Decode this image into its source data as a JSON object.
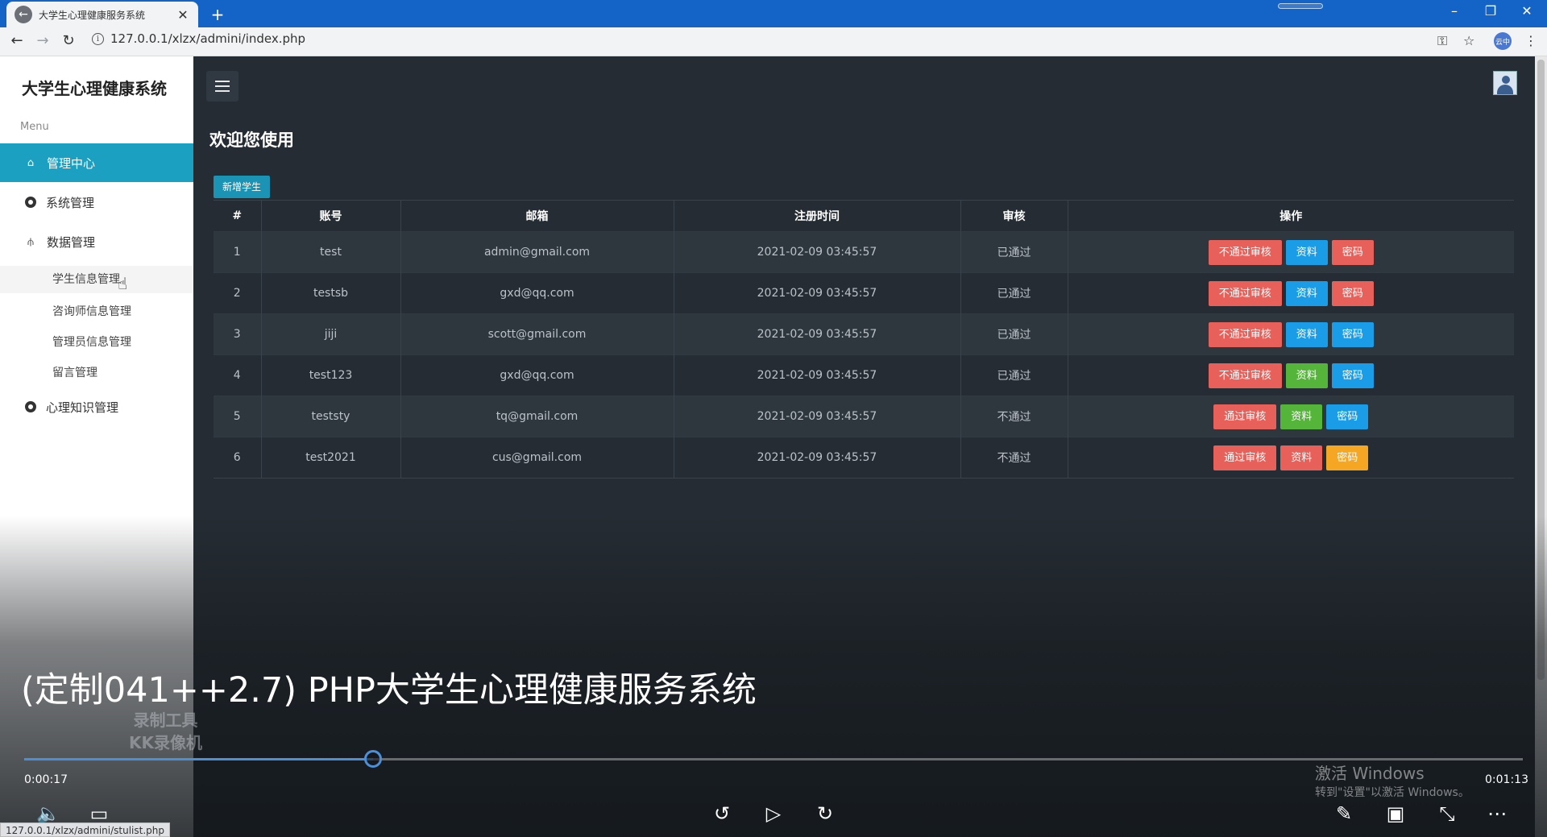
{
  "browser": {
    "tab_title": "大学生心理健康服务系统",
    "url": "127.0.0.1/xlzx/admini/index.php",
    "profile_label": "云中",
    "status_url": "127.0.0.1/xlzx/admini/stulist.php"
  },
  "sidebar": {
    "brand": "大学生心理健康系统",
    "menu_label": "Menu",
    "items": [
      {
        "label": "管理中心",
        "icon": "home-icon",
        "active": true
      },
      {
        "label": "系统管理",
        "icon": "circle-icon"
      },
      {
        "label": "数据管理",
        "icon": "usb-icon"
      },
      {
        "label": "心理知识管理",
        "icon": "circle-icon"
      }
    ],
    "sub_items": [
      {
        "label": "学生信息管理"
      },
      {
        "label": "咨询师信息管理"
      },
      {
        "label": "管理员信息管理"
      },
      {
        "label": "留言管理"
      }
    ]
  },
  "main": {
    "welcome": "欢迎您使用",
    "add_button": "新增学生",
    "table": {
      "headers": [
        "#",
        "账号",
        "邮箱",
        "注册时间",
        "审核",
        "操作"
      ],
      "rows": [
        {
          "no": "1",
          "account": "test",
          "email": "admin@gmail.com",
          "time": "2021-02-09 03:45:57",
          "status": "已通过",
          "ops": [
            {
              "label": "不通过审核",
              "color": "red"
            },
            {
              "label": "资料",
              "color": "blue"
            },
            {
              "label": "密码",
              "color": "red"
            }
          ]
        },
        {
          "no": "2",
          "account": "testsb",
          "email": "gxd@qq.com",
          "time": "2021-02-09 03:45:57",
          "status": "已通过",
          "ops": [
            {
              "label": "不通过审核",
              "color": "red"
            },
            {
              "label": "资料",
              "color": "blue"
            },
            {
              "label": "密码",
              "color": "red"
            }
          ]
        },
        {
          "no": "3",
          "account": "jiji",
          "email": "scott@gmail.com",
          "time": "2021-02-09 03:45:57",
          "status": "已通过",
          "ops": [
            {
              "label": "不通过审核",
              "color": "red"
            },
            {
              "label": "资料",
              "color": "blue"
            },
            {
              "label": "密码",
              "color": "blue"
            }
          ]
        },
        {
          "no": "4",
          "account": "test123",
          "email": "gxd@qq.com",
          "time": "2021-02-09 03:45:57",
          "status": "已通过",
          "ops": [
            {
              "label": "不通过审核",
              "color": "red"
            },
            {
              "label": "资料",
              "color": "green"
            },
            {
              "label": "密码",
              "color": "blue"
            }
          ]
        },
        {
          "no": "5",
          "account": "teststy",
          "email": "tq@gmail.com",
          "time": "2021-02-09 03:45:57",
          "status": "不通过",
          "ops": [
            {
              "label": "通过审核",
              "color": "red"
            },
            {
              "label": "资料",
              "color": "green"
            },
            {
              "label": "密码",
              "color": "blue"
            }
          ]
        },
        {
          "no": "6",
          "account": "test2021",
          "email": "cus@gmail.com",
          "time": "2021-02-09 03:45:57",
          "status": "不通过",
          "ops": [
            {
              "label": "通过审核",
              "color": "red"
            },
            {
              "label": "资料",
              "color": "red"
            },
            {
              "label": "密码",
              "color": "orange"
            }
          ]
        }
      ]
    }
  },
  "video": {
    "title": "(定制041++2.7) PHP大学生心理健康服务系统",
    "watermark_line1": "录制工具",
    "watermark_line2": "KK录像机",
    "current_time": "0:00:17",
    "duration": "0:01:13",
    "progress": 0.233,
    "win_activate_1": "激活 Windows",
    "win_activate_2": "转到\"设置\"以激活 Windows。"
  },
  "colors": {
    "tab_bar": "#1464c8",
    "sidebar_active": "#1ba0c2",
    "main_bg": "#252c33",
    "btn_red": "#e8605a",
    "btn_blue": "#1a9de6",
    "btn_green": "#55b43a",
    "btn_orange": "#f5a623"
  }
}
